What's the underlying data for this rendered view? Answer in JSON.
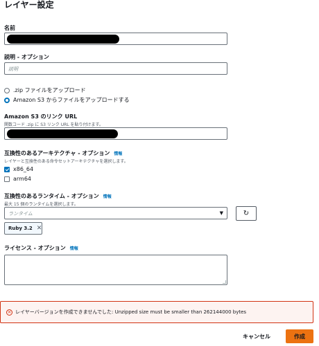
{
  "page": {
    "title": "レイヤー設定"
  },
  "name_field": {
    "label": "名前",
    "value": ""
  },
  "description_field": {
    "label": "説明 - オプション",
    "placeholder": "説明"
  },
  "upload": {
    "options": [
      {
        "label": ".zip ファイルをアップロード",
        "selected": false
      },
      {
        "label": "Amazon S3 からファイルをアップロードする",
        "selected": true
      }
    ]
  },
  "s3_link": {
    "label": "Amazon S3 のリンク URL",
    "hint": "関数コード .zip に S3 リンク URL を貼り付けます。"
  },
  "architectures": {
    "label": "互換性のあるアーキテクチャ - オプション",
    "info": "情報",
    "hint": "レイヤーと互換性のある命令セットアーキテクチャを選択します。",
    "items": [
      {
        "label": "x86_64",
        "checked": true
      },
      {
        "label": "arm64",
        "checked": false
      }
    ]
  },
  "runtimes": {
    "label": "互換性のあるランタイム - オプション",
    "info": "情報",
    "hint": "最大 15 個のランタイムを選択します。",
    "placeholder": "ランタイム",
    "selected_tokens": [
      "Ruby 3.2"
    ],
    "caret_icon": "caret-down-icon",
    "refresh_icon": "refresh-icon"
  },
  "license": {
    "label": "ライセンス - オプション",
    "info": "情報"
  },
  "error": {
    "message": "レイヤーバージョンを作成できませんでした: Unzipped size must be smaller than 262144000 bytes",
    "icon": "error-icon",
    "color": "#d13212"
  },
  "footer": {
    "cancel_label": "キャンセル",
    "create_label": "作成"
  },
  "colors": {
    "accent": "#0073bb",
    "primary_button": "#ec7211"
  }
}
